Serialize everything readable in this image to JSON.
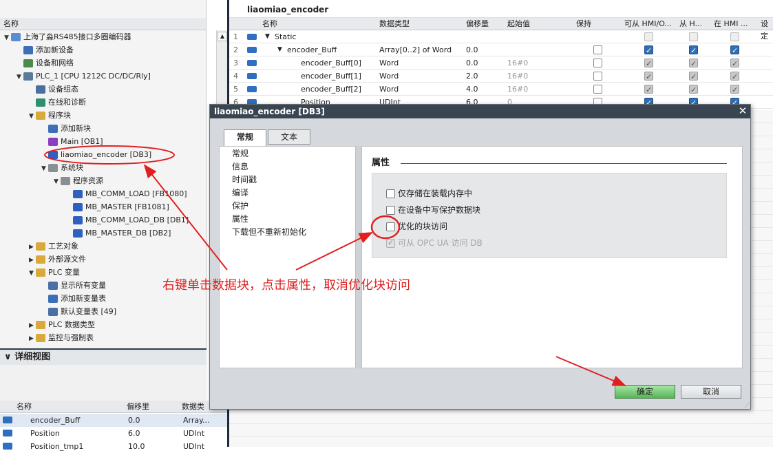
{
  "tree": {
    "header": "名称",
    "items": [
      {
        "label": "上海了淼RS485接口多圈编码器",
        "depth": 0,
        "arrow": "▼",
        "icon": "project-icon",
        "color": "#5b8ed1"
      },
      {
        "label": "添加新设备",
        "depth": 1,
        "arrow": "",
        "icon": "add-device-icon",
        "color": "#3d6fb8"
      },
      {
        "label": "设备和网络",
        "depth": 1,
        "arrow": "",
        "icon": "network-icon",
        "color": "#4a8a4a"
      },
      {
        "label": "PLC_1 [CPU 1212C DC/DC/Rly]",
        "depth": 1,
        "arrow": "▼",
        "icon": "plc-icon",
        "color": "#5a7a9a"
      },
      {
        "label": "设备组态",
        "depth": 2,
        "arrow": "",
        "icon": "config-icon",
        "color": "#4a6fa5"
      },
      {
        "label": "在线和诊断",
        "depth": 2,
        "arrow": "",
        "icon": "diagnostics-icon",
        "color": "#2f8f6f"
      },
      {
        "label": "程序块",
        "depth": 2,
        "arrow": "▼",
        "icon": "folder-icon",
        "color": "#d9a93a"
      },
      {
        "label": "添加新块",
        "depth": 3,
        "arrow": "",
        "icon": "add-block-icon",
        "color": "#3d6fb8"
      },
      {
        "label": "Main [OB1]",
        "depth": 3,
        "arrow": "",
        "icon": "ob-icon",
        "color": "#8a3fc1"
      },
      {
        "label": "liaomiao_encoder [DB3]",
        "depth": 3,
        "arrow": "",
        "icon": "db-icon",
        "color": "#2f5fbf"
      },
      {
        "label": "系统块",
        "depth": 3,
        "arrow": "▼",
        "icon": "folder-icon",
        "color": "#8a8f96"
      },
      {
        "label": "程序资源",
        "depth": 4,
        "arrow": "▼",
        "icon": "folder-icon",
        "color": "#8a8f96"
      },
      {
        "label": "MB_COMM_LOAD [FB1080]",
        "depth": 5,
        "arrow": "",
        "icon": "fb-icon",
        "color": "#2f5fbf"
      },
      {
        "label": "MB_MASTER [FB1081]",
        "depth": 5,
        "arrow": "",
        "icon": "fb-icon",
        "color": "#2f5fbf"
      },
      {
        "label": "MB_COMM_LOAD_DB [DB1]",
        "depth": 5,
        "arrow": "",
        "icon": "db-icon",
        "color": "#2f5fbf"
      },
      {
        "label": "MB_MASTER_DB [DB2]",
        "depth": 5,
        "arrow": "",
        "icon": "db-icon",
        "color": "#2f5fbf"
      },
      {
        "label": "工艺对象",
        "depth": 2,
        "arrow": "▶",
        "icon": "folder-icon",
        "color": "#d9a93a"
      },
      {
        "label": "外部源文件",
        "depth": 2,
        "arrow": "▶",
        "icon": "folder-icon",
        "color": "#d9a93a"
      },
      {
        "label": "PLC 变量",
        "depth": 2,
        "arrow": "▼",
        "icon": "folder-icon",
        "color": "#d9a93a"
      },
      {
        "label": "显示所有变量",
        "depth": 3,
        "arrow": "",
        "icon": "tags-icon",
        "color": "#4a6fa5"
      },
      {
        "label": "添加新变量表",
        "depth": 3,
        "arrow": "",
        "icon": "add-table-icon",
        "color": "#3d6fb8"
      },
      {
        "label": "默认变量表 [49]",
        "depth": 3,
        "arrow": "",
        "icon": "table-icon",
        "color": "#4a6fa5"
      },
      {
        "label": "PLC 数据类型",
        "depth": 2,
        "arrow": "▶",
        "icon": "folder-icon",
        "color": "#d9a93a"
      },
      {
        "label": "监控与强制表",
        "depth": 2,
        "arrow": "▶",
        "icon": "folder-icon",
        "color": "#d9a93a"
      }
    ]
  },
  "detail": {
    "title": "详细视图",
    "columns": [
      "名称",
      "偏移里",
      "数据类"
    ],
    "rows": [
      {
        "name": "encoder_Buff",
        "offset": "0.0",
        "type": "Array..."
      },
      {
        "name": "Position",
        "offset": "6.0",
        "type": "UDInt"
      },
      {
        "name": "Position_tmp1",
        "offset": "10.0",
        "type": "UDInt"
      }
    ]
  },
  "db": {
    "title": "liaomiao_encoder",
    "columns": [
      "名称",
      "数据类型",
      "偏移量",
      "起始值",
      "保持",
      "可从 HMI/O...",
      "从 H...",
      "在 HMI ...",
      "设定"
    ],
    "rows": [
      {
        "num": "1",
        "arrow": "▼",
        "name": "Static",
        "type": "",
        "offset": "",
        "start": "",
        "retain": "none",
        "hmi1": "grey-empty",
        "hmi2": "grey-empty",
        "hmi3": "grey-empty"
      },
      {
        "num": "2",
        "arrow": "▼",
        "name": "encoder_Buff",
        "type": "Array[0..2] of Word",
        "offset": "0.0",
        "start": "",
        "retain": "empty",
        "hmi1": "on",
        "hmi2": "on",
        "hmi3": "on"
      },
      {
        "num": "3",
        "arrow": "",
        "name": "encoder_Buff[0]",
        "type": "Word",
        "offset": "0.0",
        "start": "16#0",
        "retain": "empty",
        "hmi1": "grey",
        "hmi2": "grey",
        "hmi3": "grey"
      },
      {
        "num": "4",
        "arrow": "",
        "name": "encoder_Buff[1]",
        "type": "Word",
        "offset": "2.0",
        "start": "16#0",
        "retain": "empty",
        "hmi1": "grey",
        "hmi2": "grey",
        "hmi3": "grey"
      },
      {
        "num": "5",
        "arrow": "",
        "name": "encoder_Buff[2]",
        "type": "Word",
        "offset": "4.0",
        "start": "16#0",
        "retain": "empty",
        "hmi1": "grey",
        "hmi2": "grey",
        "hmi3": "grey"
      },
      {
        "num": "6",
        "arrow": "",
        "name": "Position",
        "type": "UDInt",
        "offset": "6.0",
        "start": "0",
        "retain": "empty",
        "hmi1": "on",
        "hmi2": "on",
        "hmi3": "on"
      }
    ]
  },
  "dialog": {
    "title": "liaomiao_encoder [DB3]",
    "tabs": [
      "常规",
      "文本"
    ],
    "nav": [
      "常规",
      "信息",
      "时间戳",
      "编译",
      "保护",
      "属性",
      "下载但不重新初始化"
    ],
    "section_title": "属性",
    "options": [
      {
        "label": "仅存储在装载内存中",
        "disabled": false
      },
      {
        "label": "在设备中写保护数据块",
        "disabled": false
      },
      {
        "label": "优化的块访问",
        "disabled": false
      },
      {
        "label": "可从 OPC UA 访问 DB",
        "disabled": true
      }
    ],
    "ok_label": "确定",
    "cancel_label": "取消"
  },
  "annotation": {
    "text": "右键单击数据块，点击属性，取消优化块访问",
    "color": "#e02020"
  }
}
